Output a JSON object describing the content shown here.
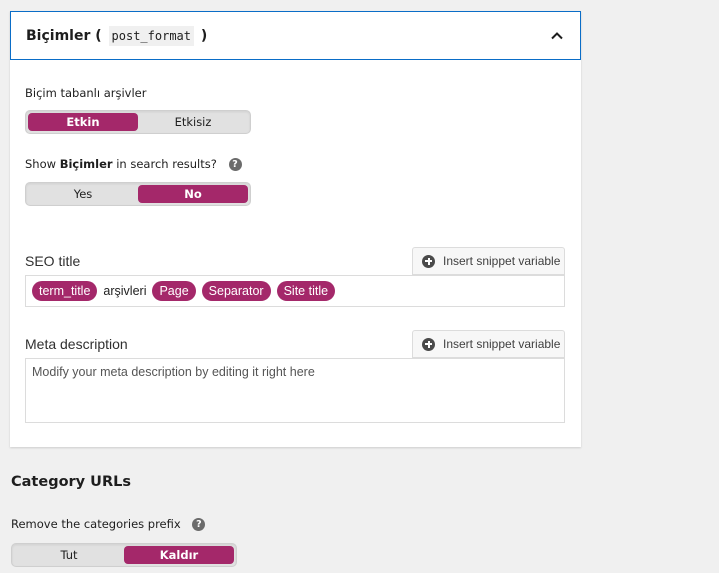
{
  "panel": {
    "title": "Biçimler (",
    "title_code": "post_format",
    "title_close": ")",
    "collapse_icon": "chevron-up-icon"
  },
  "archives": {
    "label": "Biçim tabanlı arşivler",
    "options": [
      "Etkin",
      "Etkisiz"
    ],
    "selected": "Etkin"
  },
  "search_results": {
    "label_prefix": "Show ",
    "label_bold": "Biçimler",
    "label_suffix": " in search results?",
    "help_icon": "question-circle-icon",
    "help_glyph": "?",
    "options": [
      "Yes",
      "No"
    ],
    "selected": "No"
  },
  "seo_title": {
    "label": "SEO title",
    "insert_button": "Insert snippet variable",
    "chip1": "term_title",
    "text1": "arşivleri",
    "chip2": "Page",
    "chip3": "Separator",
    "chip4": "Site title"
  },
  "meta_description": {
    "label": "Meta description",
    "insert_button": "Insert snippet variable",
    "placeholder": "Modify your meta description by editing it right here"
  },
  "category_urls": {
    "heading": "Category URLs",
    "prefix_label": "Remove the categories prefix",
    "help_glyph": "?",
    "options": [
      "Tut",
      "Kaldır"
    ],
    "selected": "Kaldır"
  },
  "colors": {
    "accent": "#a4286a",
    "focus_border": "#0a6dc7"
  }
}
